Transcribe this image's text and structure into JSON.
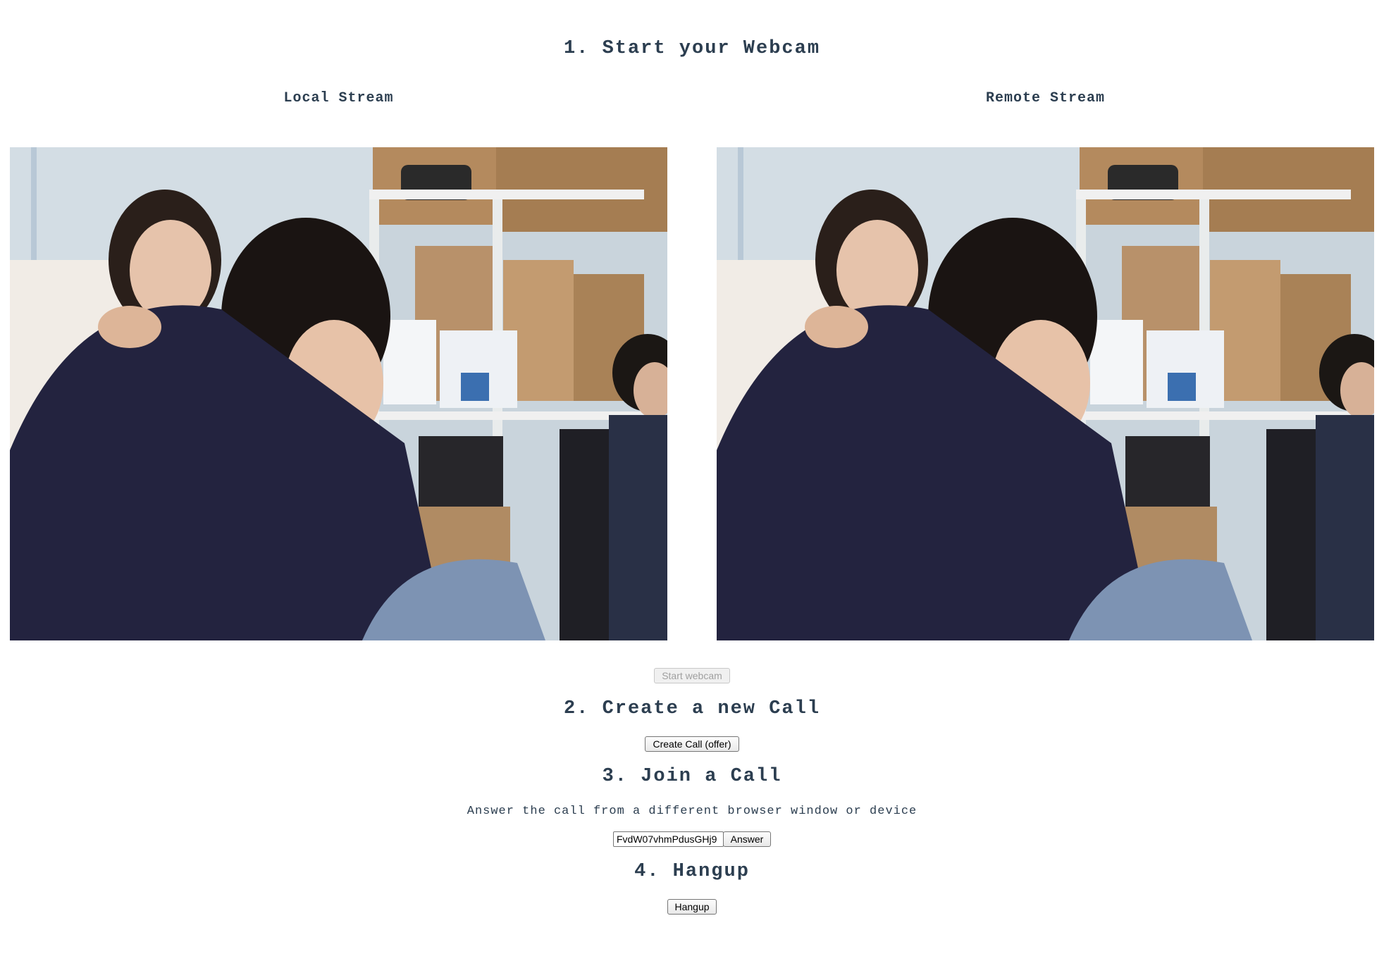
{
  "sections": {
    "webcam": {
      "heading": "1. Start your Webcam",
      "local_label": "Local Stream",
      "remote_label": "Remote Stream",
      "start_button": "Start webcam",
      "start_disabled": true
    },
    "create": {
      "heading": "2. Create a new Call",
      "create_button": "Create Call (offer)"
    },
    "join": {
      "heading": "3. Join a Call",
      "description": "Answer the call from a different browser window or device",
      "call_id_value": "FvdW07vhmPdusGHj9",
      "answer_button": "Answer"
    },
    "hangup": {
      "heading": "4. Hangup",
      "hangup_button": "Hangup"
    }
  },
  "colors": {
    "heading_text": "#2c3e50"
  }
}
